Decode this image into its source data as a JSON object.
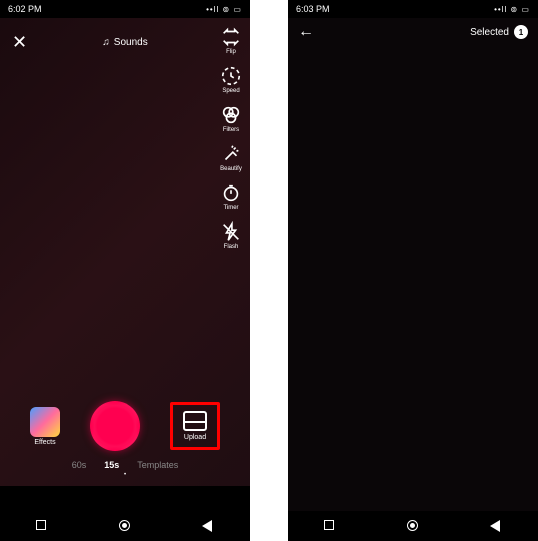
{
  "left": {
    "status": {
      "time": "6:02 PM"
    },
    "topbar": {
      "sounds_label": "Sounds"
    },
    "tools": [
      {
        "name": "flip-icon",
        "label": "Flip"
      },
      {
        "name": "speed-icon",
        "label": "Speed"
      },
      {
        "name": "filters-icon",
        "label": "Filters"
      },
      {
        "name": "beautify-icon",
        "label": "Beautify"
      },
      {
        "name": "timer-icon",
        "label": "Timer"
      },
      {
        "name": "flash-icon",
        "label": "Flash"
      }
    ],
    "effects_label": "Effects",
    "upload_label": "Upload",
    "tabs": {
      "t60": "60s",
      "t15": "15s",
      "templates": "Templates"
    }
  },
  "right": {
    "status": {
      "time": "6:03 PM"
    },
    "selected_label": "Selected",
    "selected_count": "1"
  }
}
